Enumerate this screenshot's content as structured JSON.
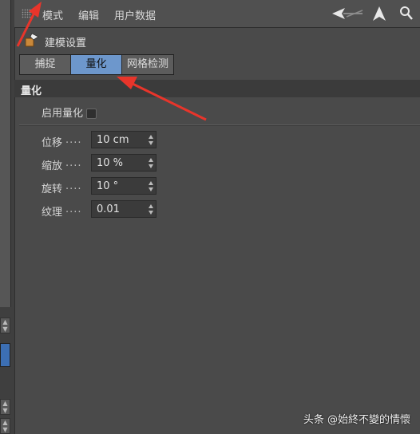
{
  "menubar": {
    "items": [
      "模式",
      "编辑",
      "用户数据"
    ]
  },
  "title": "建模设置",
  "tabs": [
    {
      "label": "捕捉",
      "active": false
    },
    {
      "label": "量化",
      "active": true
    },
    {
      "label": "网格检测",
      "active": false
    }
  ],
  "section": {
    "title": "量化"
  },
  "enable": {
    "label": "启用量化",
    "checked": false
  },
  "fields": [
    {
      "label": "位移",
      "dots": "....",
      "value": "10 cm"
    },
    {
      "label": "缩放",
      "dots": "....",
      "value": "10 %"
    },
    {
      "label": "旋转",
      "dots": "....",
      "value": "10 °"
    },
    {
      "label": "纹理",
      "dots": "....",
      "value": "0.01"
    }
  ],
  "watermark": "头条 @始終不變的情懷",
  "colors": {
    "active_tab": "#6d97cc",
    "annotation": "#e8352b"
  }
}
